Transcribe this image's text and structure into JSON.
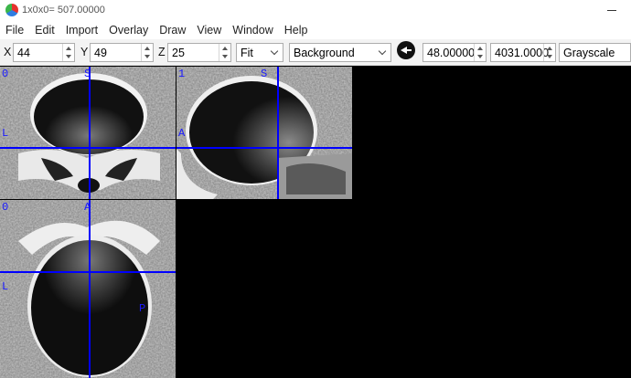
{
  "window": {
    "title": "1x0x0= 507.00000"
  },
  "menu": [
    "File",
    "Edit",
    "Import",
    "Overlay",
    "Draw",
    "View",
    "Window",
    "Help"
  ],
  "toolbar": {
    "x_label": "X",
    "x_value": "44",
    "y_label": "Y",
    "y_value": "49",
    "z_label": "Z",
    "z_value": "25",
    "zoom": "Fit",
    "layer": "Background",
    "min_value": "48.00000",
    "max_value": "4031.0000",
    "colormap": "Grayscale"
  },
  "panels": {
    "coronal": {
      "index": "0",
      "top_label": "S",
      "left_label": "L"
    },
    "sagittal": {
      "index": "1",
      "top_label": "S",
      "left_label": "A"
    },
    "axial": {
      "index": "0",
      "top_label": "A",
      "left_label": "L",
      "right_label": "P"
    }
  },
  "colors": {
    "crosshair": "#0000ff",
    "label": "#1a1aff",
    "background": "#000000"
  }
}
